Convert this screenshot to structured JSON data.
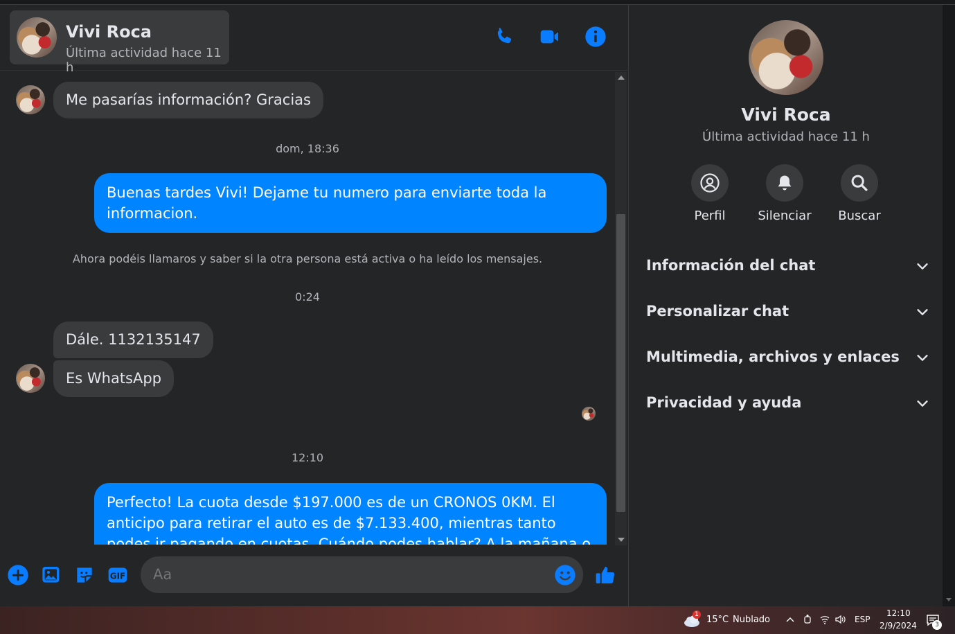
{
  "contact": {
    "name": "Vivi Roca",
    "status": "Última actividad hace 11 h"
  },
  "header_icons": [
    "phone-icon",
    "video-camera-icon",
    "info-icon"
  ],
  "messages": {
    "m1": "Me pasarías información? Gracias",
    "ts1": "dom, 18:36",
    "m2": "Buenas tardes Vivi! Dejame tu numero para enviarte toda la informacion.",
    "system": "Ahora podéis llamaros y saber si la otra persona está activa o ha leído los mensajes.",
    "ts2": "0:24",
    "m3": "Dále. 1132135147",
    "m4": "Es WhatsApp",
    "ts3": "12:10",
    "m5": "Perfecto! La cuota desde $197.000 es de un CRONOS 0KM. El anticipo para retirar el auto es de $7.133.400, mientras tanto podes ir pagando en cuotas. Cuándo podes hablar? A la mañana o a la tarde?"
  },
  "composer": {
    "placeholder": "Aa",
    "icons": [
      "plus-icon",
      "image-icon",
      "sticker-icon",
      "gif-icon",
      "emoji-icon",
      "like-icon"
    ],
    "gif_label": "GIF"
  },
  "info_panel": {
    "name": "Vivi Roca",
    "status": "Última actividad hace 11 h",
    "actions": [
      {
        "label": "Perfil",
        "icon": "profile-icon"
      },
      {
        "label": "Silenciar",
        "icon": "bell-icon"
      },
      {
        "label": "Buscar",
        "icon": "search-icon"
      }
    ],
    "sections": [
      "Información del chat",
      "Personalizar chat",
      "Multimedia, archivos y enlaces",
      "Privacidad y ayuda"
    ]
  },
  "taskbar": {
    "weather": "15°C",
    "weather_desc": "Nublado",
    "weather_badge": "1",
    "language": "ESP",
    "time": "12:10",
    "date": "2/9/2024",
    "notifications": "3"
  },
  "colors": {
    "accent": "#0084ff",
    "bubble_in": "#3a3b3c",
    "background": "#242526"
  }
}
